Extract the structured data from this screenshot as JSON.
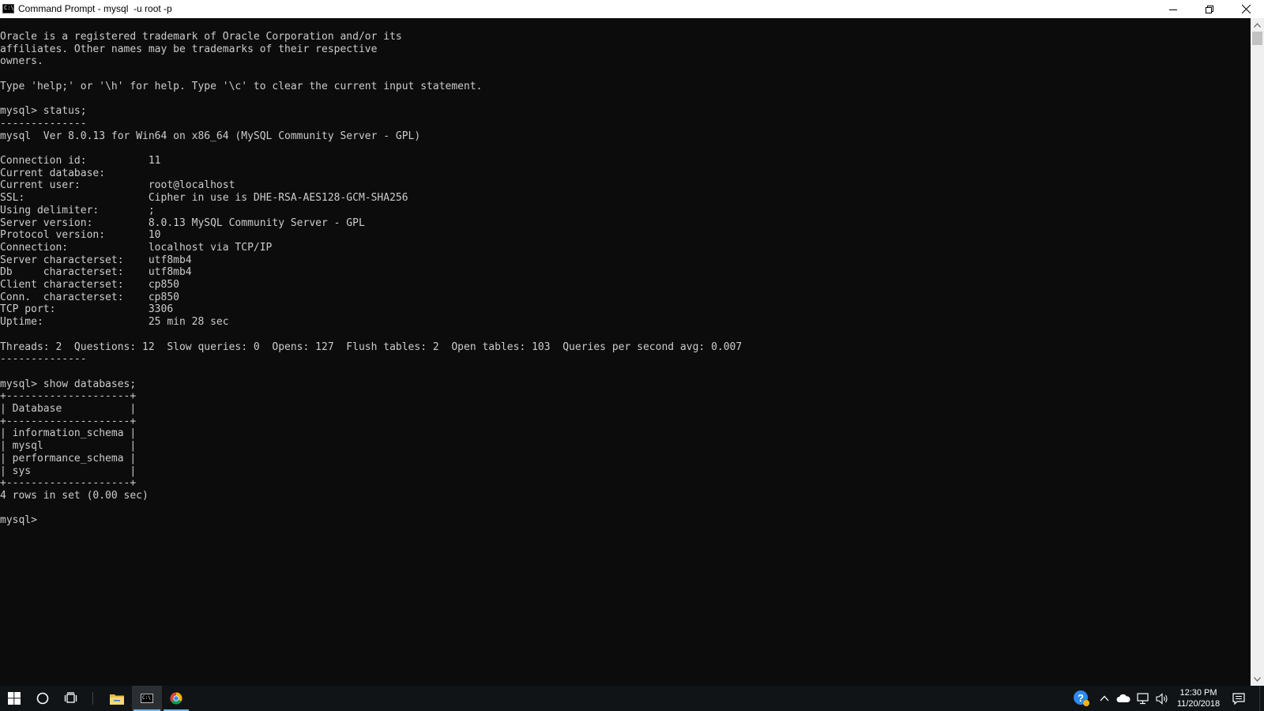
{
  "window": {
    "title": "Command Prompt - mysql  -u root -p",
    "app_icon_text": "C:\\",
    "minimize_label": "Minimize",
    "restore_label": "Restore",
    "close_label": "Close"
  },
  "console": {
    "lines": [
      "Oracle is a registered trademark of Oracle Corporation and/or its",
      "affiliates. Other names may be trademarks of their respective",
      "owners.",
      "",
      "Type 'help;' or '\\h' for help. Type '\\c' to clear the current input statement.",
      "",
      "mysql> status;",
      "--------------",
      "mysql  Ver 8.0.13 for Win64 on x86_64 (MySQL Community Server - GPL)",
      "",
      "Connection id:          11",
      "Current database:",
      "Current user:           root@localhost",
      "SSL:                    Cipher in use is DHE-RSA-AES128-GCM-SHA256",
      "Using delimiter:        ;",
      "Server version:         8.0.13 MySQL Community Server - GPL",
      "Protocol version:       10",
      "Connection:             localhost via TCP/IP",
      "Server characterset:    utf8mb4",
      "Db     characterset:    utf8mb4",
      "Client characterset:    cp850",
      "Conn.  characterset:    cp850",
      "TCP port:               3306",
      "Uptime:                 25 min 28 sec",
      "",
      "Threads: 2  Questions: 12  Slow queries: 0  Opens: 127  Flush tables: 2  Open tables: 103  Queries per second avg: 0.007",
      "--------------",
      "",
      "mysql> show databases;",
      "+--------------------+",
      "| Database           |",
      "+--------------------+",
      "| information_schema |",
      "| mysql              |",
      "| performance_schema |",
      "| sys                |",
      "+--------------------+",
      "4 rows in set (0.00 sec)",
      "",
      "mysql>"
    ]
  },
  "taskbar": {
    "apps": [
      {
        "name": "file-explorer",
        "icon": "folder-icon"
      },
      {
        "name": "command-prompt",
        "icon": "cmd-icon",
        "active": true
      },
      {
        "name": "chrome",
        "icon": "chrome-icon"
      }
    ],
    "cmd_icon_text": "C:\\",
    "clock_time": "12:30 PM",
    "clock_date": "11/20/2018"
  },
  "colors": {
    "console_bg": "#0c0c0c",
    "console_text": "#cccccc",
    "taskbar_bg": "#101417",
    "accent": "#76b9ed"
  }
}
